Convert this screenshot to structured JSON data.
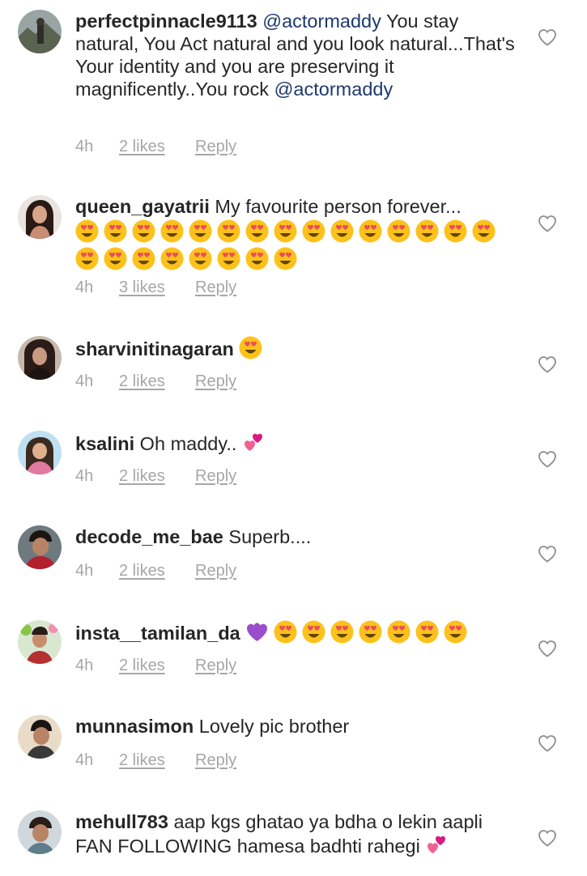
{
  "comments": [
    {
      "username": "perfectpinnacle9113",
      "mention": "@actormaddy",
      "text": " You stay natural, You Act natural and you look natural...That's Your identity and you are preserving it magnificently..You rock ",
      "mention2": "@actormaddy",
      "time": "4h",
      "likes": "2 likes",
      "reply": "Reply"
    },
    {
      "username": "queen_gayatrii",
      "text": " My favourite person forever...",
      "emoji_name": "heart-eyes-emoji",
      "emoji_count": 23,
      "time": "4h",
      "likes": "3 likes",
      "reply": "Reply"
    },
    {
      "username": "sharvinitinagaran",
      "text": "",
      "emoji_name": "heart-eyes-emoji",
      "time": "4h",
      "likes": "2 likes",
      "reply": "Reply"
    },
    {
      "username": "ksalini",
      "text": " Oh maddy..",
      "emoji_name": "two-hearts-emoji",
      "time": "4h",
      "likes": "2 likes",
      "reply": "Reply"
    },
    {
      "username": "decode_me_bae",
      "text": " Superb....",
      "time": "4h",
      "likes": "2 likes",
      "reply": "Reply"
    },
    {
      "username": "insta__tamilan_da",
      "text": "",
      "emoji_name": "purple-heart-and-heart-eyes-emoji",
      "emoji_count": 7,
      "time": "4h",
      "likes": "2 likes",
      "reply": "Reply"
    },
    {
      "username": "munnasimon",
      "text": " Lovely pic brother",
      "time": "4h",
      "likes": "2 likes",
      "reply": "Reply"
    },
    {
      "username": "mehull783",
      "text": " aap kgs ghatao ya bdha o lekin aapli FAN FOLLOWING hamesa badhti rahegi",
      "emoji_name": "two-hearts-emoji"
    }
  ],
  "icons": {
    "like": "heart-outline-icon"
  },
  "colors": {
    "text": "#262626",
    "meta": "#a6a6a6",
    "mention": "#1d3a6e",
    "heart_outline": "#8e8e8e"
  }
}
